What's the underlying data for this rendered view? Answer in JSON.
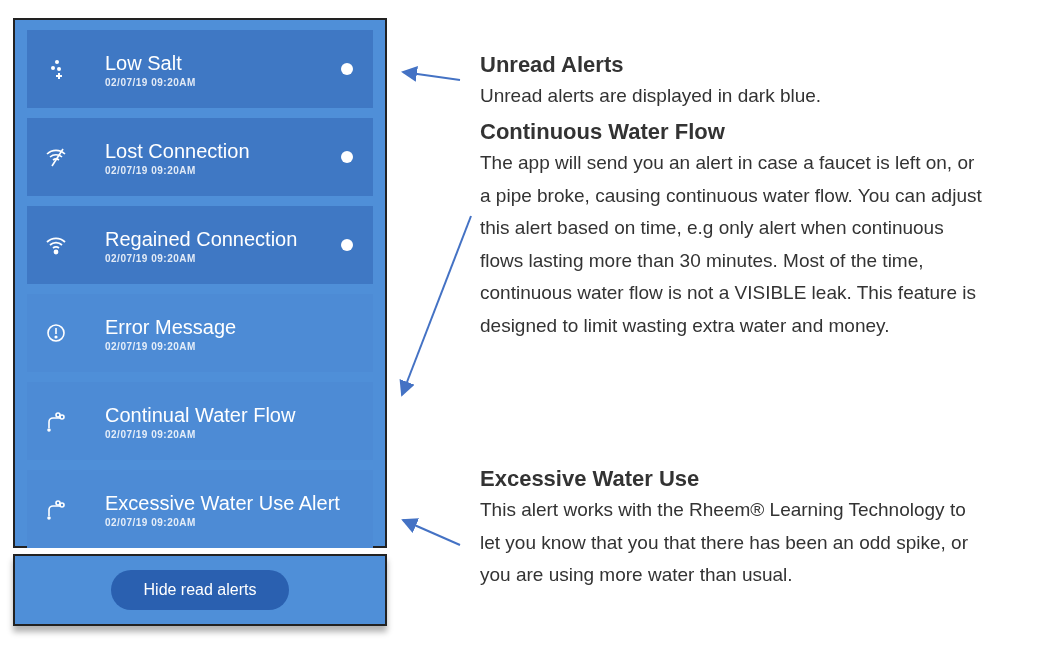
{
  "alerts": [
    {
      "kind": "salt",
      "title": "Low Salt",
      "time": "02/07/19 09:20AM",
      "unread": true
    },
    {
      "kind": "wifi-off",
      "title": "Lost Connection",
      "time": "02/07/19 09:20AM",
      "unread": true
    },
    {
      "kind": "wifi",
      "title": "Regained Connection",
      "time": "02/07/19 09:20AM",
      "unread": true
    },
    {
      "kind": "error",
      "title": "Error Message",
      "time": "02/07/19 09:20AM",
      "unread": false
    },
    {
      "kind": "faucet",
      "title": "Continual Water Flow",
      "time": "02/07/19 09:20AM",
      "unread": false
    },
    {
      "kind": "faucet",
      "title": "Excessive Water Use Alert",
      "time": "02/07/19 09:20AM",
      "unread": false
    }
  ],
  "hide_button": "Hide read alerts",
  "annotations": [
    {
      "title": "Unread Alerts",
      "body": "Unread alerts are displayed in dark blue."
    },
    {
      "title": "Continuous Water Flow",
      "body": "The app will send you an alert in case a faucet is left on, or a pipe broke, causing continuous water flow. You can adjust this alert based on time, e.g only alert when continuous flows lasting more than 30 minutes. Most of the time, continuous water flow is not a VISIBLE leak. This feature is designed to limit wasting extra water and money."
    },
    {
      "title": "Excessive Water Use",
      "body": "This alert works with the Rheem® Learning Technology to let you know that you that there has been an odd spike, or you are using more water than usual."
    }
  ]
}
